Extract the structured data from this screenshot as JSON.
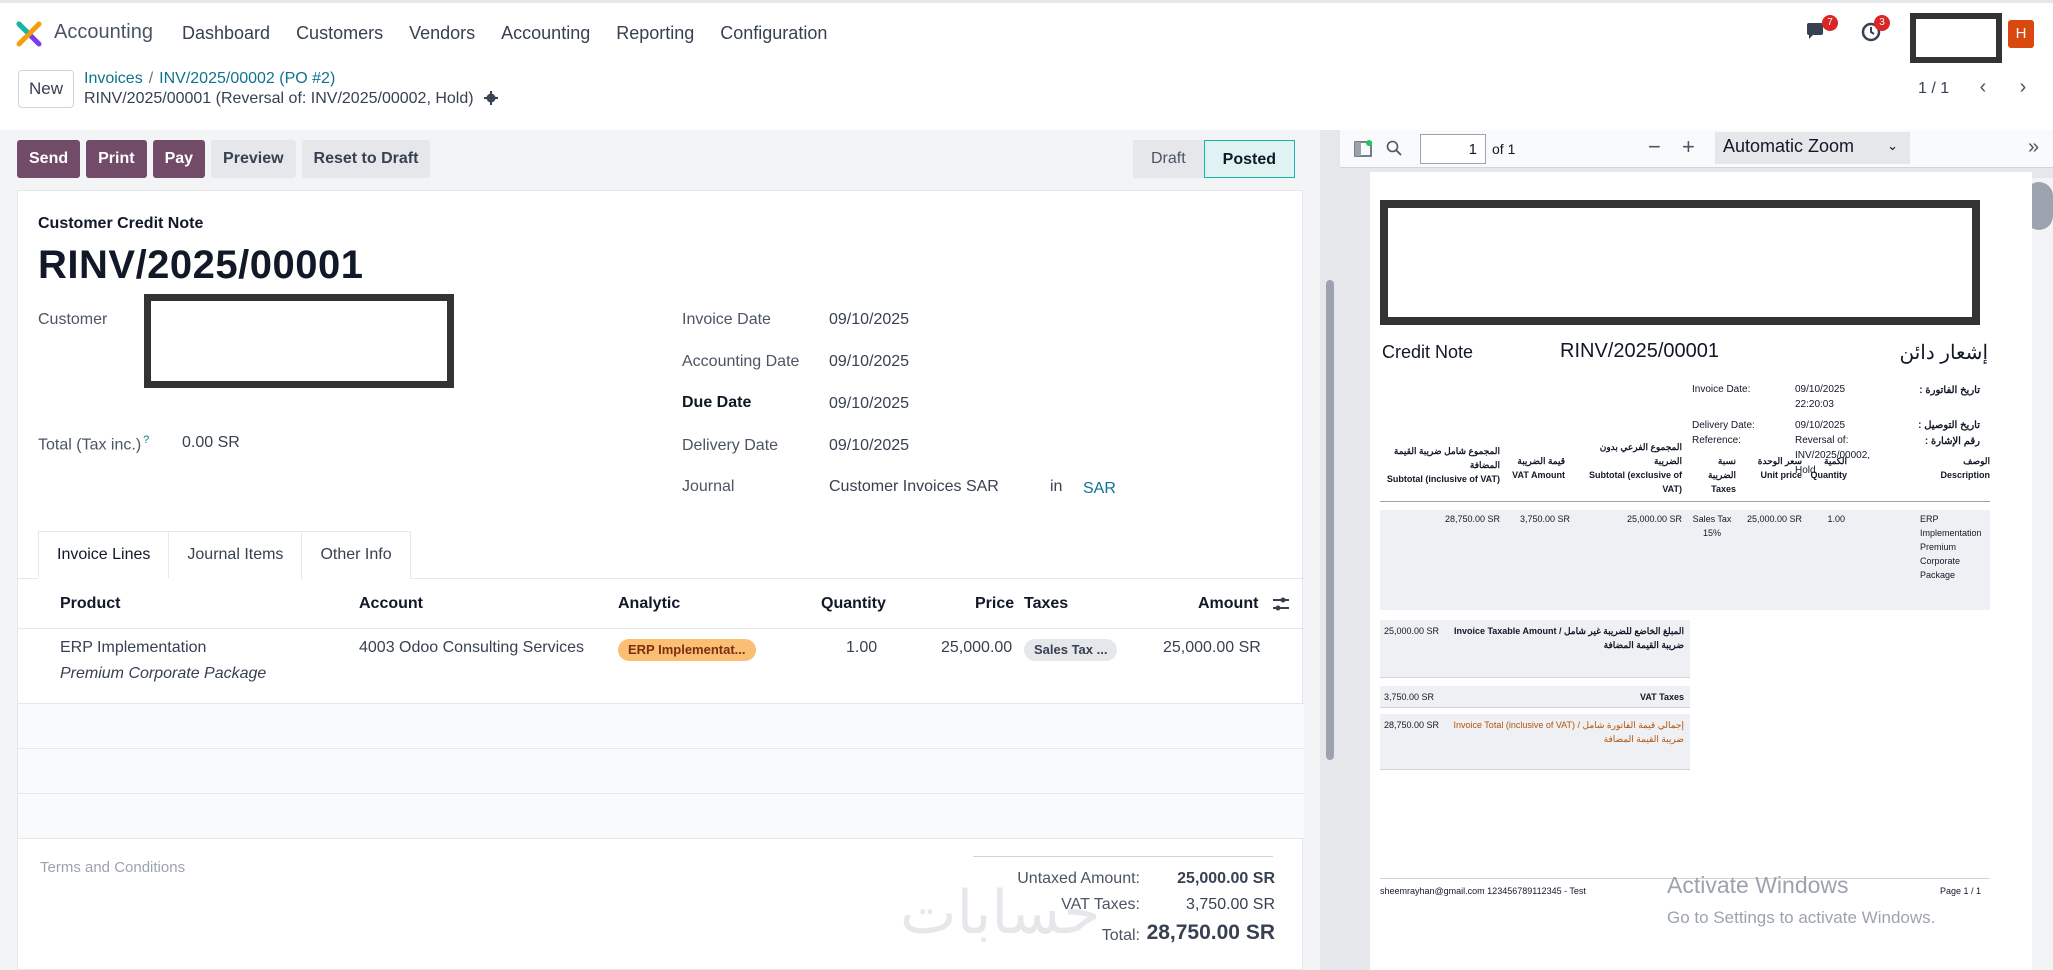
{
  "nav": {
    "app_name": "Accounting",
    "menu": [
      "Dashboard",
      "Customers",
      "Vendors",
      "Accounting",
      "Reporting",
      "Configuration"
    ],
    "chat_badge": "7",
    "activity_badge": "3",
    "avatar_letter": "H"
  },
  "control": {
    "new_label": "New",
    "breadcrumb": [
      "Invoices",
      "INV/2025/00002 (PO #2)"
    ],
    "record_name": "RINV/2025/00001 (Reversal of: INV/2025/00002, Hold)",
    "pager": "1 / 1"
  },
  "actions": [
    "Send",
    "Print",
    "Pay",
    "Preview",
    "Reset to Draft"
  ],
  "status": {
    "draft": "Draft",
    "posted": "Posted"
  },
  "form": {
    "doc_type": "Customer Credit Note",
    "number": "RINV/2025/00001",
    "customer_label": "Customer",
    "total_label": "Total (Tax inc.)",
    "total_help": "?",
    "total_value": "0.00 SR",
    "invoice_date_label": "Invoice Date",
    "invoice_date": "09/10/2025",
    "accounting_date_label": "Accounting Date",
    "accounting_date": "09/10/2025",
    "due_date_label": "Due Date",
    "due_date": "09/10/2025",
    "delivery_date_label": "Delivery Date",
    "delivery_date": "09/10/2025",
    "journal_label": "Journal",
    "journal": "Customer Invoices SAR",
    "journal_in": "in",
    "currency": "SAR"
  },
  "tabs": [
    "Invoice Lines",
    "Journal Items",
    "Other Info"
  ],
  "lines": {
    "headers": {
      "product": "Product",
      "account": "Account",
      "analytic": "Analytic",
      "quantity": "Quantity",
      "price": "Price",
      "taxes": "Taxes",
      "amount": "Amount"
    },
    "rows": [
      {
        "product": "ERP Implementation",
        "description": "Premium Corporate Package",
        "account": "4003 Odoo Consulting Services",
        "analytic": "ERP Implementat...",
        "quantity": "1.00",
        "price": "25,000.00",
        "taxes": "Sales Tax ...",
        "amount": "25,000.00 SR"
      }
    ]
  },
  "terms": "Terms and Conditions",
  "totals": {
    "untaxed_label": "Untaxed Amount:",
    "untaxed": "25,000.00 SR",
    "vat_label": "VAT Taxes:",
    "vat": "3,750.00 SR",
    "total_label": "Total:",
    "total": "28,750.00 SR"
  },
  "watermark": "حسابات",
  "pdf": {
    "page": "1",
    "of": "of 1",
    "zoom": "Automatic Zoom",
    "title": "Credit Note",
    "number": "RINV/2025/00001",
    "ar_title": "إشعار دائن",
    "invoice_date_label": "Invoice Date:",
    "invoice_date": "09/10/2025",
    "invoice_time": "22:20:03",
    "invoice_date_ar": "تاريخ الفاتورة :",
    "delivery_date_label": "Delivery Date:",
    "delivery_date": "09/10/2025",
    "delivery_date_ar": "تاريخ التوصيل :",
    "reference_label": "Reference:",
    "reference_1": "Reversal of:",
    "reference_2": "INV/2025/00002,",
    "reference_3": "Hold",
    "reference_ar": "رقم الإشارة :",
    "col_total_ar": "المجموع شامل ضريبة القيمة المضافة",
    "col_total_en": "Subtotal (inclusive of VAT)",
    "col_vat_ar": "قيمة الضريبة",
    "col_vat_en": "VAT Amount",
    "col_sub_ar": "المجموع الفرعي بدون الضريبة",
    "col_sub_en": "Subtotal (exclusive of VAT)",
    "col_tax_ar": "نسبة الضريبة",
    "col_tax_en": "Taxes",
    "col_price_ar": "سعر الوحدة",
    "col_price_en": "Unit price",
    "col_qty_ar": "الكمية",
    "col_qty_en": "Quantity",
    "col_desc_ar": "الوصف",
    "col_desc_en": "Description",
    "row_total": "28,750.00 SR",
    "row_vat": "3,750.00 SR",
    "row_sub": "25,000.00 SR",
    "row_tax": "Sales Tax 15%",
    "row_price": "25,000.00 SR",
    "row_qty": "1.00",
    "row_desc": "ERP Implementation Premium Corporate Package",
    "sum_taxable_val": "25,000.00 SR",
    "sum_taxable_label": "Invoice Taxable Amount / المبلغ الخاضع للضريبة غير شامل ضريبة القيمة المضافة",
    "sum_vat_val": "3,750.00 SR",
    "sum_vat_label": "VAT Taxes",
    "sum_total_val": "28,750.00 SR",
    "sum_total_label": "Invoice Total (inclusive of VAT) / إجمالي قيمة الفاتورة شامل ضريبة القيمة المضافة",
    "footer": "sheemrayhan@gmail.com 123456789112345 - Test",
    "page_label": "Page 1 / 1",
    "activate_1": "Activate Windows",
    "activate_2": "Go to Settings to activate Windows."
  }
}
